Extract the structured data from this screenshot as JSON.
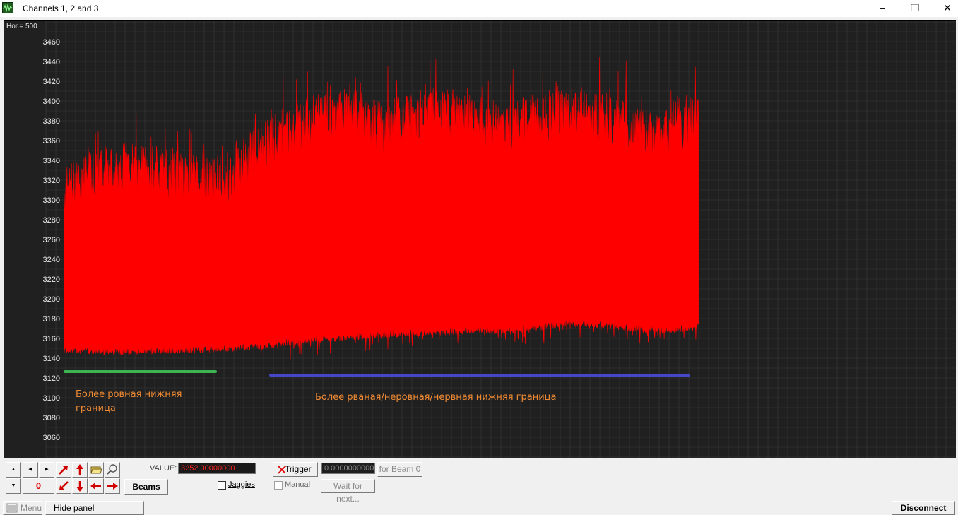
{
  "window": {
    "title": "Channels 1, 2 and 3",
    "minimize_glyph": "‒",
    "maximize_glyph": "❐",
    "close_glyph": "✕"
  },
  "plot": {
    "hor_label": "Hor.= 500",
    "annotation_left": [
      "Более ровная нижняя",
      "граница"
    ],
    "annotation_right": "Более рваная/неровная/нервная нижняя граница",
    "annotation_color": "#f08a32",
    "left_marker_color": "#3cb550",
    "right_marker_color": "#4646c8"
  },
  "chart_data": {
    "type": "line",
    "x_range": [
      0,
      1000
    ],
    "y_ticks": [
      3060,
      3080,
      3100,
      3120,
      3140,
      3160,
      3180,
      3200,
      3220,
      3240,
      3260,
      3280,
      3300,
      3320,
      3340,
      3360,
      3380,
      3400,
      3420,
      3440,
      3460
    ],
    "ylim": [
      3050,
      3470
    ],
    "grid": true,
    "series": [
      {
        "color": "#ff0000",
        "x": [
          0,
          50,
          100,
          150,
          200,
          250,
          300,
          350,
          400,
          450,
          500,
          550,
          600,
          650,
          700,
          750,
          800,
          850,
          900,
          950,
          1000
        ],
        "y_low": [
          3145,
          3144,
          3143,
          3144,
          3145,
          3146,
          3148,
          3152,
          3155,
          3158,
          3160,
          3162,
          3163,
          3165,
          3164,
          3168,
          3172,
          3170,
          3166,
          3165,
          3168
        ],
        "y_high": [
          3320,
          3340,
          3345,
          3340,
          3335,
          3330,
          3360,
          3380,
          3395,
          3400,
          3385,
          3395,
          3400,
          3390,
          3385,
          3395,
          3400,
          3395,
          3380,
          3385,
          3395
        ]
      }
    ],
    "annotations": [
      "Более ровная нижняя граница",
      "Более рваная/неровная/нервная нижняя граница"
    ]
  },
  "panel": {
    "nav_up": "▲",
    "nav_down": "▼",
    "nav_left": "◀",
    "nav_right": "▶",
    "counter": "0",
    "beams_label": "Beams",
    "value_label": "VALUE:",
    "value_text": "3252.00000000",
    "value_color": "#ff2020",
    "jaggies_label": "Jaggies",
    "trigger_label": "Trigger",
    "trigger_value": "0.0000000000",
    "for_beam_label": "for Beam 0",
    "manual_label": "Manual",
    "wait_label": "Wait for next...",
    "menu_label": "Menu",
    "hide_panel_label": "Hide panel",
    "disconnect_label": "Disconnect"
  }
}
